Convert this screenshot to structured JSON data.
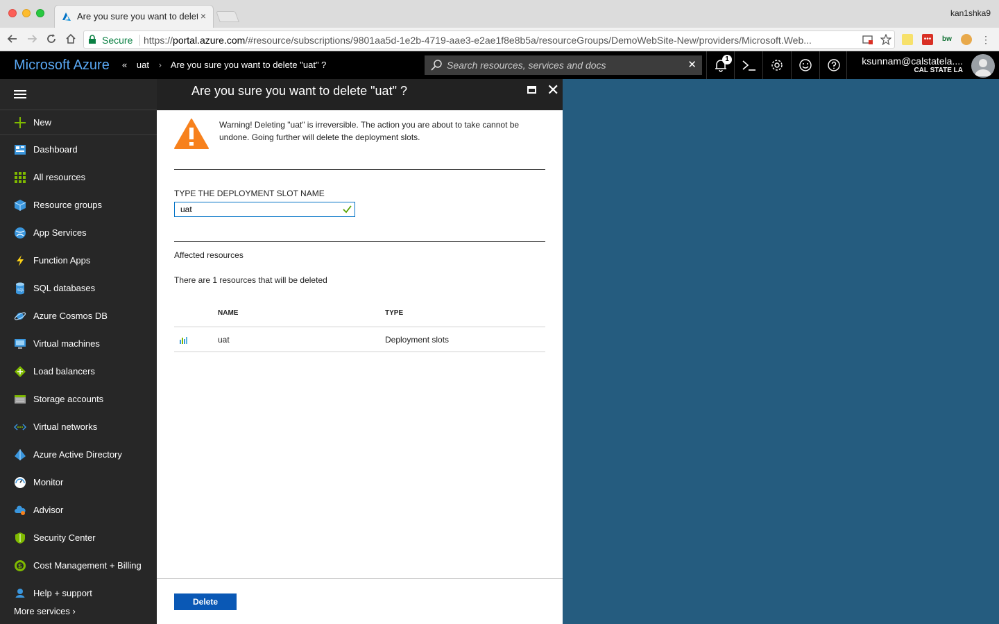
{
  "browser": {
    "tab_title": "Are you sure you want to delete",
    "tab_close": "×",
    "profile_name": "kan1shka9",
    "secure_label": "Secure",
    "url_scheme": "https://",
    "url_host": "portal.azure.com",
    "url_rest": "/#resource/subscriptions/9801aa5d-1e2b-4719-aae3-e2ae1f8e8b5a/resourceGroups/DemoWebSite-New/providers/Microsoft.Web..."
  },
  "topbar": {
    "brand": "Microsoft Azure",
    "crumb_back": "«",
    "crumb_1": "uat",
    "crumb_sep": "›",
    "crumb_2": "Are you sure you want to delete \"uat\" ?",
    "search_placeholder": "Search resources, services and docs",
    "search_clear": "✕",
    "notification_count": "1",
    "user_email": "ksunnam@calstatela....",
    "user_org": "CAL STATE LA"
  },
  "sidebar": {
    "items": [
      {
        "label": "New",
        "icon": "plus-icon"
      },
      {
        "label": "Dashboard",
        "icon": "dashboard-icon"
      },
      {
        "label": "All resources",
        "icon": "grid-icon"
      },
      {
        "label": "Resource groups",
        "icon": "cube-icon"
      },
      {
        "label": "App Services",
        "icon": "globe-icon"
      },
      {
        "label": "Function Apps",
        "icon": "bolt-icon"
      },
      {
        "label": "SQL databases",
        "icon": "database-icon"
      },
      {
        "label": "Azure Cosmos DB",
        "icon": "planet-icon"
      },
      {
        "label": "Virtual machines",
        "icon": "monitor-icon"
      },
      {
        "label": "Load balancers",
        "icon": "diamond-icon"
      },
      {
        "label": "Storage accounts",
        "icon": "storage-icon"
      },
      {
        "label": "Virtual networks",
        "icon": "network-icon"
      },
      {
        "label": "Azure Active Directory",
        "icon": "pyramid-icon"
      },
      {
        "label": "Monitor",
        "icon": "gauge-icon"
      },
      {
        "label": "Advisor",
        "icon": "cloud-icon"
      },
      {
        "label": "Security Center",
        "icon": "shield-icon"
      },
      {
        "label": "Cost Management + Billing",
        "icon": "coin-icon"
      },
      {
        "label": "Help + support",
        "icon": "person-icon"
      }
    ],
    "more_services": "More services ›"
  },
  "blade": {
    "title": "Are you sure you want to delete \"uat\" ?",
    "close": "✕",
    "warning": "Warning! Deleting \"uat\" is irreversible. The action you are about to take cannot be undone. Going further will delete the deployment slots.",
    "field_label": "TYPE THE DEPLOYMENT SLOT NAME",
    "field_value": "uat",
    "affected_heading": "Affected resources",
    "affected_info": "There are 1 resources that will be deleted",
    "table": {
      "headers": [
        "NAME",
        "TYPE"
      ],
      "rows": [
        {
          "name": "uat",
          "type": "Deployment slots"
        }
      ]
    },
    "delete_label": "Delete"
  },
  "colors": {
    "azure_blue": "#5aa9f5",
    "dashboard_bg": "#255c7f",
    "delete_button": "#0a58b5",
    "warning_orange": "#f7811d"
  }
}
